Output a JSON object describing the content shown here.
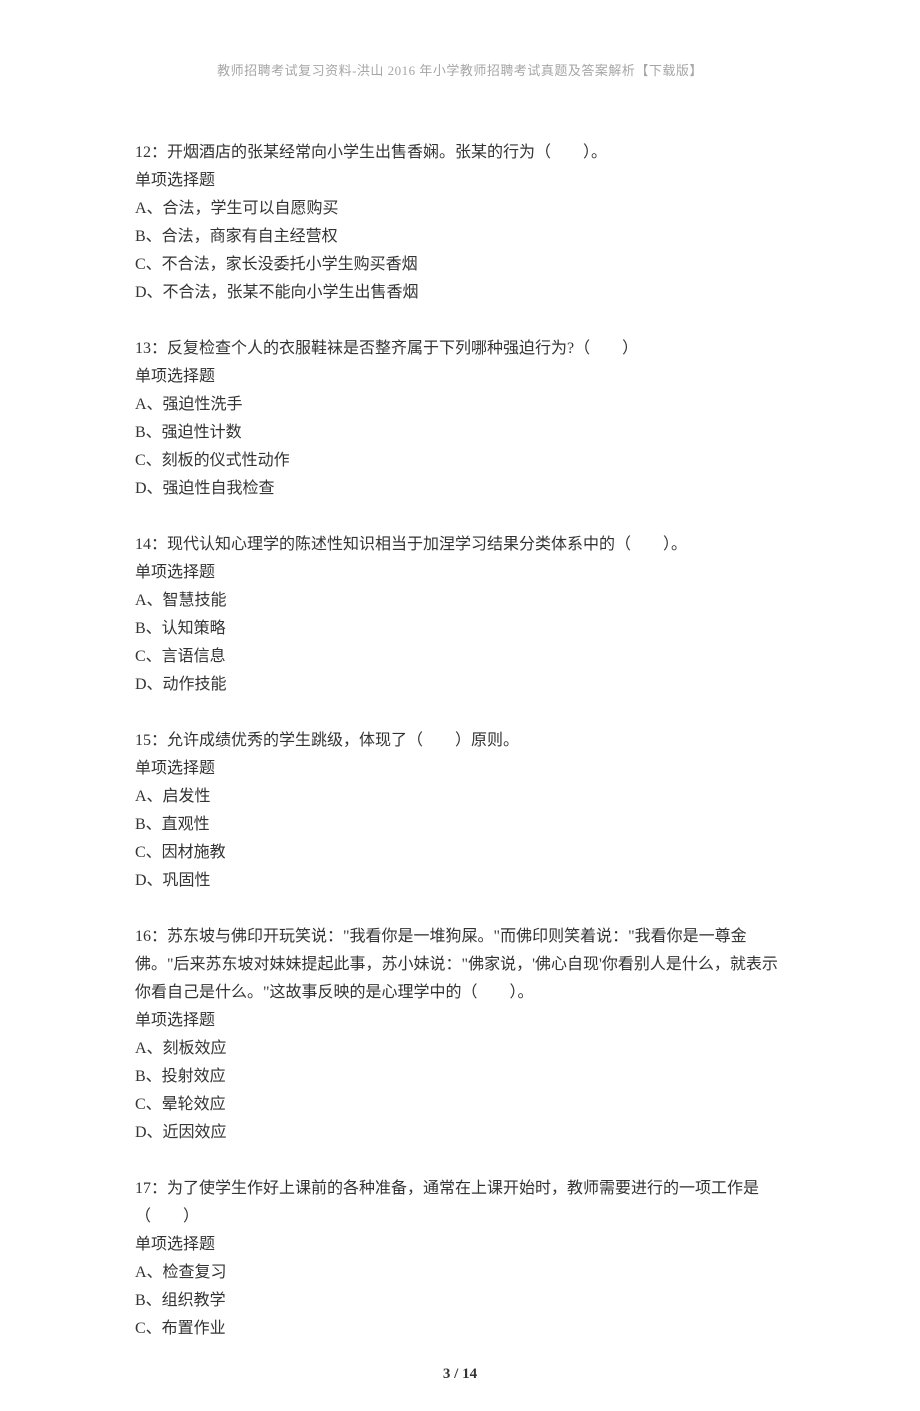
{
  "header": "教师招聘考试复习资料-洪山 2016 年小学教师招聘考试真题及答案解析【下载版】",
  "page_indicator": "3 / 14",
  "questions": [
    {
      "number": "12",
      "stem": "开烟酒店的张某经常向小学生出售香娴。张某的行为（　　）。",
      "type": "单项选择题",
      "options": [
        "A、合法，学生可以自愿购买",
        "B、合法，商家有自主经营权",
        "C、不合法，家长没委托小学生购买香烟",
        "D、不合法，张某不能向小学生出售香烟"
      ]
    },
    {
      "number": "13",
      "stem": "反复检查个人的衣服鞋袜是否整齐属于下列哪种强迫行为?（　　）",
      "type": "单项选择题",
      "options": [
        "A、强迫性洗手",
        "B、强迫性计数",
        "C、刻板的仪式性动作",
        "D、强迫性自我检查"
      ]
    },
    {
      "number": "14",
      "stem": "现代认知心理学的陈述性知识相当于加涅学习结果分类体系中的（　　）。",
      "type": "单项选择题",
      "options": [
        "A、智慧技能",
        "B、认知策略",
        "C、言语信息",
        "D、动作技能"
      ]
    },
    {
      "number": "15",
      "stem": "允许成绩优秀的学生跳级，体现了（　　）原则。",
      "type": "单项选择题",
      "options": [
        "A、启发性",
        "B、直观性",
        "C、因材施教",
        "D、巩固性"
      ]
    },
    {
      "number": "16",
      "stem": "苏东坡与佛印开玩笑说：\"我看你是一堆狗屎。\"而佛印则笑着说：\"我看你是一尊金佛。\"后来苏东坡对妹妹提起此事，苏小妹说：\"佛家说，'佛心自现'你看别人是什么，就表示你看自己是什么。\"这故事反映的是心理学中的（　　）。",
      "type": "单项选择题",
      "options": [
        "A、刻板效应",
        "B、投射效应",
        "C、晕轮效应",
        "D、近因效应"
      ]
    },
    {
      "number": "17",
      "stem": "为了使学生作好上课前的各种准备，通常在上课开始时，教师需要进行的一项工作是（　　）",
      "type": "单项选择题",
      "options": [
        "A、检查复习",
        "B、组织教学",
        "C、布置作业"
      ]
    }
  ]
}
